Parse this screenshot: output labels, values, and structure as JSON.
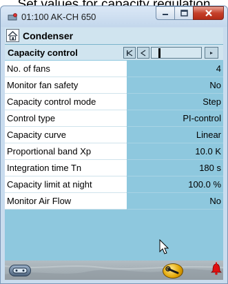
{
  "caption": "Set values for capacity regulation",
  "window": {
    "title": "01:100 AK-CH 650"
  },
  "header": {
    "title": "Condenser"
  },
  "section": {
    "title": "Capacity control"
  },
  "parameters": [
    {
      "label": "No. of fans",
      "value": "4"
    },
    {
      "label": "Monitor fan safety",
      "value": "No"
    },
    {
      "label": "Capacity control mode",
      "value": "Step"
    },
    {
      "label": "Control type",
      "value": "PI-control"
    },
    {
      "label": "Capacity curve",
      "value": "Linear"
    },
    {
      "label": "Proportional band Xp",
      "value": "10.0 K"
    },
    {
      "label": "Integration time Tn",
      "value": "180 s"
    },
    {
      "label": "Capacity limit at night",
      "value": "100.0 %"
    },
    {
      "label": "Monitor Air Flow",
      "value": "No"
    }
  ],
  "footer": {
    "left_icon": "controller-icon",
    "middle_icon": "wrench-icon",
    "right_icon": "alarm-bell-icon"
  },
  "colors": {
    "value_background": "#8ec8de",
    "header_background": "#d0e4ef",
    "close_button": "#c5402a"
  }
}
